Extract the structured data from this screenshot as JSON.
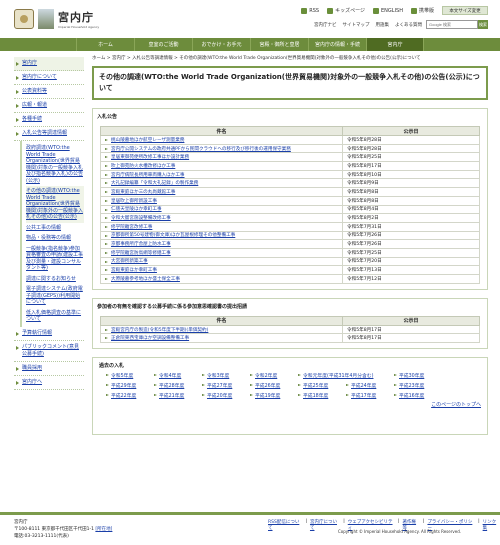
{
  "header": {
    "logo_jp": "宮内庁",
    "logo_en": "Imperial Household Agency",
    "top_links": [
      "RSS",
      "キッズページ",
      "ENGLISH",
      "携帯版"
    ],
    "sitemap_button": "本文サイズ変更",
    "sub_links": [
      "宮内庁ナビ",
      "サイトマップ",
      "用語集",
      "よくある質問"
    ],
    "search_placeholder": "Google 検索",
    "search_button": "検索"
  },
  "nav": [
    "ホーム",
    "皇室のご活動",
    "おでかけ・お手元",
    "宮殿・御所と皇居",
    "宮内庁の情報・手続",
    "宮内庁"
  ],
  "sidebar": {
    "items_top": [
      "宮内庁",
      "宮内庁について",
      "公表資料等",
      "広報・報道",
      "各種手続",
      "入札公告等調達情報"
    ],
    "sub_items": [
      "政府調達(WTO:the World Trade Organization(世界貿易機関)対象の一般競争入札及び指名競争入札)の公告(公示)",
      "その他の調達(WTO:the World Trade Organization(世界貿易機関)対象外の一般競争入札その他)の公告(公示)",
      "公共工事の情報",
      "物品・役務等の情報",
      "一般競争(指名競争)参加資格審査の申請(建設工事及び測量・建設コンサルタント等)",
      "調達に関するお知らせ",
      "電子調達システム(政府電子調達(GEPS))利用開始について",
      "低入札価格調査の基準について"
    ],
    "items_bottom": [
      "予算執行情報",
      "パブリックコメント(意見公募手続)",
      "職員採用",
      "宮内庁へ"
    ]
  },
  "breadcrumb": "ホーム > 宮内庁 > 入札公告等調達情報 > その他の調達(WTO:the World Trade Organization(世界貿易機関)対象外の一般競争入札その他)の公告(公示)について",
  "page_title": "その他の調達(WTO:the World Trade Organization(世界貿易機関)対象外の一般競争入札その他)の公告(公示)について",
  "section1": {
    "heading": "入札公告",
    "col_name": "件名",
    "col_date": "公示日",
    "rows": [
      {
        "name": "桃山陵墓地ほか航空レーザ測量業務",
        "date": "令和5年8月28日"
      },
      {
        "name": "宮内庁公開システムの政府共通PFから民間クラウドへの移行及び移行後の運用保守業務",
        "date": "令和5年8月28日"
      },
      {
        "name": "皇居東御苑便所改修工事ほか設計業務",
        "date": "令和5年8月25日"
      },
      {
        "name": "吹上御苑防火水槽改修ほか工事",
        "date": "令和5年8月17日"
      },
      {
        "name": "宮内庁病院長所用車両購入ほか工事",
        "date": "令和5年8月10日"
      },
      {
        "name": "大礼記録編纂「令和大礼記録」の製作業務",
        "date": "令和5年8月9日"
      },
      {
        "name": "宮殿東庭ほか三の丸尚蔵館工事",
        "date": "令和5年8月8日"
      },
      {
        "name": "皇居吹上御所新設工事",
        "date": "令和5年8月8日"
      },
      {
        "name": "仁徳天皇陵ほか幸町工事",
        "date": "令和5年8月4日"
      },
      {
        "name": "令和大嘗宮施設整備改修工事",
        "date": "令和5年8月2日"
      },
      {
        "name": "修学院離宮改修工事",
        "date": "令和5年7月31日"
      },
      {
        "name": "京都御所第50号建物(御文庫)ほか瓦屋根修理その他整備工事",
        "date": "令和5年7月26日"
      },
      {
        "name": "京都事務所庁舎屋上防水工事",
        "date": "令和5年7月26日"
      },
      {
        "name": "修学院離宮防鳥網等修繕工事",
        "date": "令和5年7月25日"
      },
      {
        "name": "大宮御所新築工事",
        "date": "令和5年7月20日"
      },
      {
        "name": "宮殿東庭ほか幸町工事",
        "date": "令和5年7月13日"
      },
      {
        "name": "大原陵墓参考地ほか盛土保全工事",
        "date": "令和5年7月12日"
      }
    ]
  },
  "section2": {
    "heading": "参加者の有無を確認する公募手続に係る参加意思確認書の提出招請",
    "col_name": "件名",
    "col_date": "公示日",
    "rows": [
      {
        "name": "宮殿宮内庁の製造(令和5年度下半期)(単価契約)",
        "date": "令和5年8月17日"
      },
      {
        "name": "正倉院東西宝庫ほか空調設備整備工事",
        "date": "令和5年8月17日"
      }
    ]
  },
  "past": {
    "heading": "過去の入札",
    "years_row1": [
      "令和5年度",
      "令和4年度",
      "令和3年度",
      "令和2年度",
      "令和元年度(平成31年4月分含む)",
      "平成30年度",
      "平成29年度"
    ],
    "years_row2": [
      "平成28年度",
      "平成27年度",
      "平成26年度",
      "平成25年度",
      "平成24年度",
      "平成23年度",
      "平成22年度",
      "平成21年度"
    ],
    "years_row3": [
      "平成20年度",
      "平成19年度",
      "平成18年度",
      "平成17年度",
      "平成16年度"
    ],
    "page_top": "このページのトップへ"
  },
  "footer": {
    "org": "宮内庁",
    "address": "〒100-8111 東京都千代田区千代田1-1",
    "map_link": "[所在地]",
    "phone": "電話:03-3213-1111(代表)",
    "links": [
      "RSS配信について",
      "宮内庁について",
      "ウェブアクセシビリティ",
      "著作権等",
      "プライバシー・ポリシー",
      "リンク集"
    ],
    "copyright": "Copyright © Imperial Household Agency. All Rights Reserved."
  }
}
